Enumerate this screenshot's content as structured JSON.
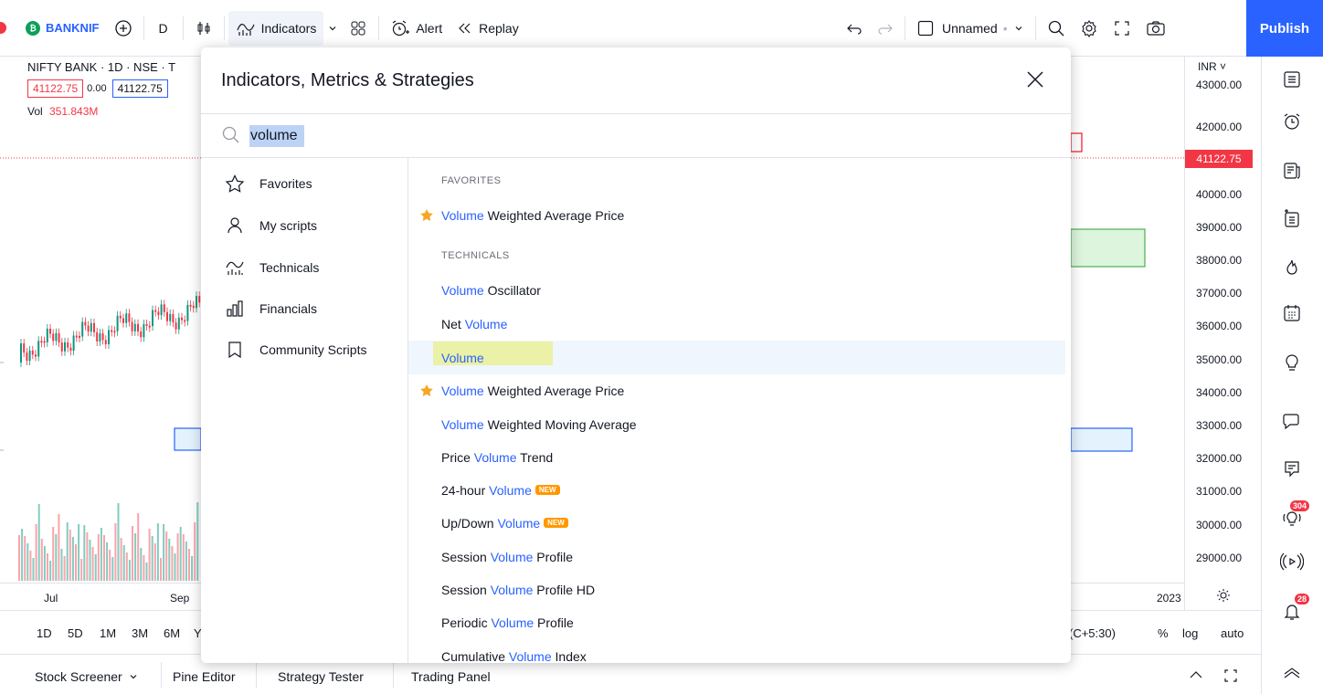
{
  "toolbar": {
    "symbol": "BANKNIF",
    "symbol_logo": "₿",
    "interval": "D",
    "indicators_label": "Indicators",
    "alert_label": "Alert",
    "replay_label": "Replay",
    "layout_name": "Unnamed",
    "publish_label": "Publish"
  },
  "legend": {
    "title": "NIFTY BANK · 1D · NSE · T",
    "open_value": "41122.75",
    "change": "0.00",
    "close_value": "41122.75",
    "vol_label": "Vol",
    "vol_value": "351.843M"
  },
  "price_axis": {
    "currency": "INR",
    "current": "41122.75",
    "labels": [
      "43000.00",
      "42000.00",
      "40000.00",
      "39000.00",
      "38000.00",
      "37000.00",
      "36000.00",
      "35000.00",
      "34000.00",
      "33000.00",
      "32000.00",
      "31000.00",
      "30000.00",
      "29000.00"
    ]
  },
  "time_axis": {
    "labels": [
      "Jul",
      "Sep",
      "2023"
    ]
  },
  "range_bar": {
    "items": [
      "1D",
      "5D",
      "1M",
      "3M",
      "6M",
      "Y"
    ],
    "timezone": "(C+5:30)",
    "percent": "%",
    "log": "log",
    "auto": "auto"
  },
  "bottom_bar": {
    "tabs": [
      "Stock Screener",
      "Pine Editor",
      "Strategy Tester",
      "Trading Panel"
    ]
  },
  "right_bar": {
    "badge_ideas": "304",
    "badge_notifications": "28"
  },
  "modal": {
    "title": "Indicators, Metrics & Strategies",
    "search_value": "volume",
    "nav": [
      "Favorites",
      "My scripts",
      "Technicals",
      "Financials",
      "Community Scripts"
    ],
    "sections": {
      "favorites": "FAVORITES",
      "technicals": "TECHNICALS"
    },
    "new_badge": "NEW",
    "results": [
      {
        "pre": "",
        "hl": "Volume",
        "post": " Weighted Average Price",
        "star": true,
        "new": false
      },
      {
        "pre": "",
        "hl": "Volume",
        "post": " Oscillator",
        "star": false,
        "new": false
      },
      {
        "pre": "Net ",
        "hl": "Volume",
        "post": "",
        "star": false,
        "new": false
      },
      {
        "pre": "",
        "hl": "Volume",
        "post": "",
        "star": false,
        "new": false,
        "selected": true
      },
      {
        "pre": "",
        "hl": "Volume",
        "post": " Weighted Average Price",
        "star": true,
        "new": false
      },
      {
        "pre": "",
        "hl": "Volume",
        "post": " Weighted Moving Average",
        "star": false,
        "new": false
      },
      {
        "pre": "Price ",
        "hl": "Volume",
        "post": " Trend",
        "star": false,
        "new": false
      },
      {
        "pre": "24-hour ",
        "hl": "Volume",
        "post": "",
        "star": false,
        "new": true
      },
      {
        "pre": "Up/Down ",
        "hl": "Volume",
        "post": "",
        "star": false,
        "new": true
      },
      {
        "pre": "Session ",
        "hl": "Volume",
        "post": " Profile",
        "star": false,
        "new": false
      },
      {
        "pre": "Session ",
        "hl": "Volume",
        "post": " Profile HD",
        "star": false,
        "new": false
      },
      {
        "pre": "Periodic ",
        "hl": "Volume",
        "post": " Profile",
        "star": false,
        "new": false
      },
      {
        "pre": "Cumulative ",
        "hl": "Volume",
        "post": " Index",
        "star": false,
        "new": false
      }
    ]
  },
  "colors": {
    "accent": "#2962ff",
    "down": "#f23645",
    "up": "#089981",
    "selected_row": "#e3effd",
    "marker": "#f2f21a"
  }
}
